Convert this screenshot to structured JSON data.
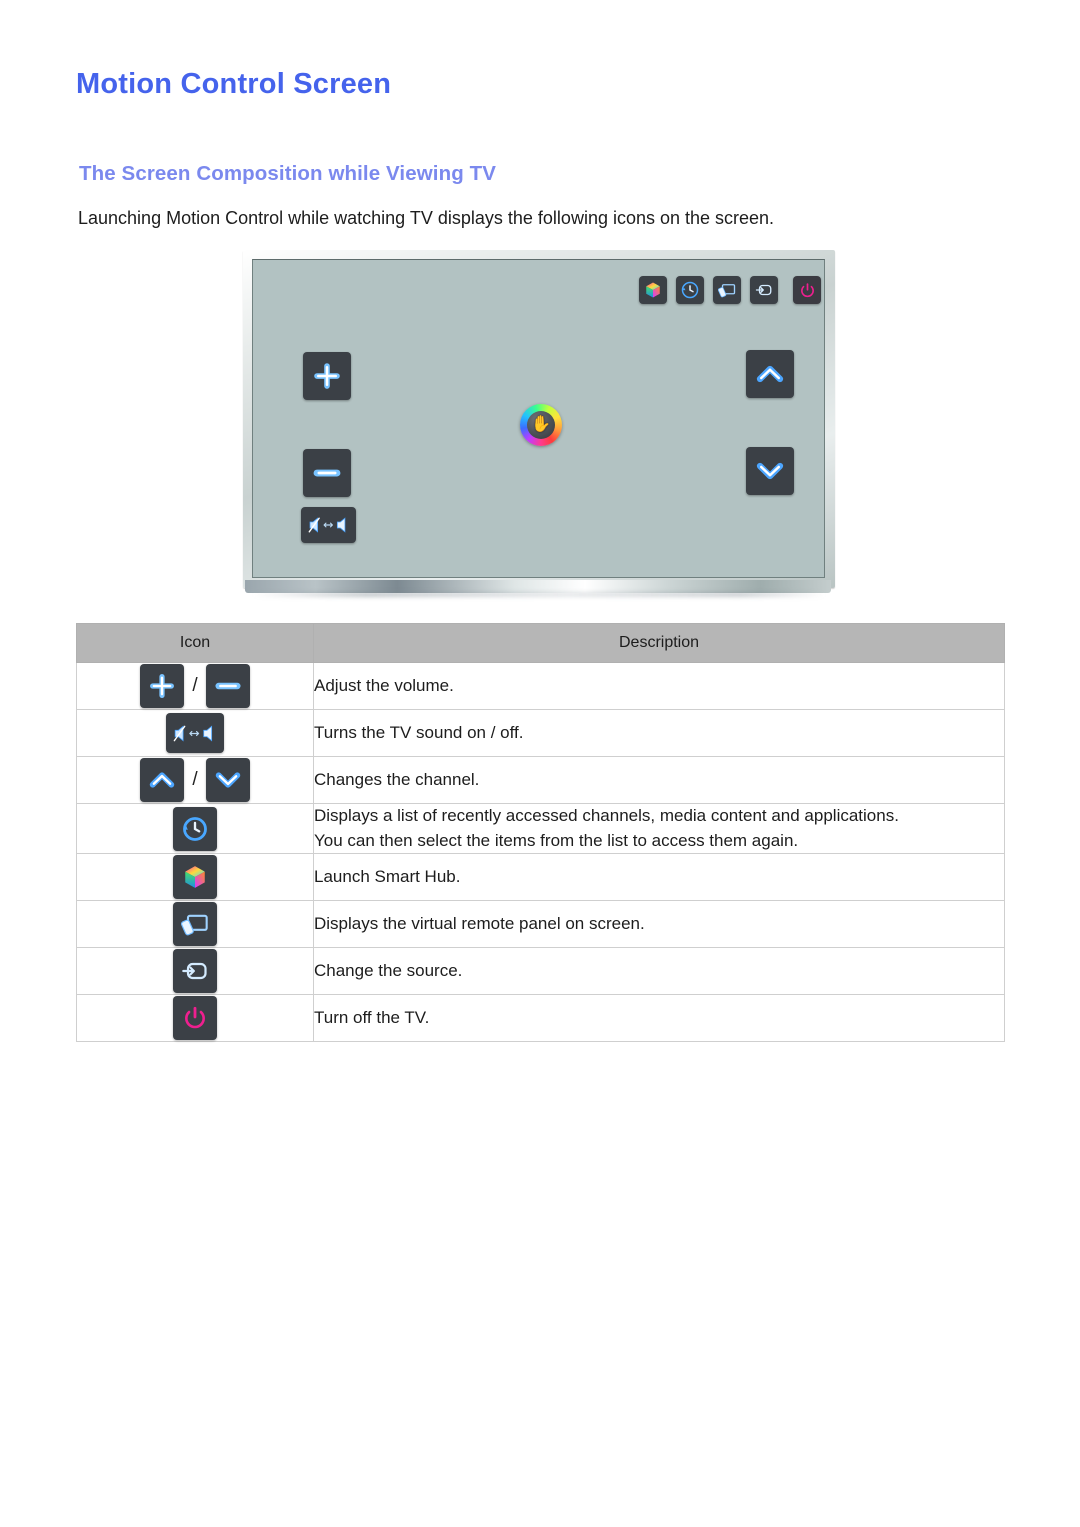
{
  "document": {
    "title": "Motion Control Screen",
    "subtitle": "The Screen Composition while Viewing TV",
    "intro": "Launching Motion Control while watching TV displays the following icons on the screen."
  },
  "colors": {
    "title_blue": "#4563ec",
    "subtitle_blue": "#7b89ee",
    "table_header_gray": "#b6b6b6",
    "tv_screen": "#b2c2c2",
    "icon_tile": "#3b4046",
    "icon_glow_blue": "#2e86ff",
    "power_magenta": "#ef1f8f"
  },
  "tv_illustration": {
    "name": "tv-screen-overlay",
    "onscreen_icons": [
      {
        "id": "volume-up",
        "icon": "plus-icon",
        "position": "left-upper"
      },
      {
        "id": "volume-down",
        "icon": "minus-icon",
        "position": "left-lower"
      },
      {
        "id": "mute-toggle",
        "icon": "mute-speaker-toggle-icon",
        "position": "left-bottom"
      },
      {
        "id": "channel-up",
        "icon": "chevron-up-icon",
        "position": "right-upper"
      },
      {
        "id": "channel-down",
        "icon": "chevron-down-icon",
        "position": "right-lower"
      },
      {
        "id": "smart-hub",
        "icon": "smart-hub-cube-icon",
        "position": "top-right-bar"
      },
      {
        "id": "recent",
        "icon": "clock-history-icon",
        "position": "top-right-bar"
      },
      {
        "id": "virtual-remote",
        "icon": "virtual-remote-panel-icon",
        "position": "top-right-bar"
      },
      {
        "id": "source",
        "icon": "source-input-icon",
        "position": "top-right-bar"
      },
      {
        "id": "power",
        "icon": "power-icon",
        "position": "top-right-bar"
      }
    ],
    "cursor": {
      "icon": "hand-cursor-icon",
      "glyph": "✋"
    }
  },
  "table": {
    "headers": {
      "icon": "Icon",
      "description": "Description"
    },
    "rows": [
      {
        "icons": [
          "plus-icon",
          "minus-icon"
        ],
        "separator": "/",
        "description": "Adjust the volume."
      },
      {
        "icons": [
          "mute-speaker-toggle-icon"
        ],
        "separator": "",
        "description": "Turns the TV sound on / off."
      },
      {
        "icons": [
          "chevron-up-icon",
          "chevron-down-icon"
        ],
        "separator": "/",
        "description": "Changes the channel."
      },
      {
        "icons": [
          "clock-history-icon"
        ],
        "separator": "",
        "description": "Displays a list of recently accessed channels, media content and applications.",
        "description_line2": "You can then select the items from the list to access them again."
      },
      {
        "icons": [
          "smart-hub-cube-icon"
        ],
        "separator": "",
        "description": "Launch Smart Hub."
      },
      {
        "icons": [
          "virtual-remote-panel-icon"
        ],
        "separator": "",
        "description": "Displays the virtual remote panel on screen."
      },
      {
        "icons": [
          "source-input-icon"
        ],
        "separator": "",
        "description": "Change the source."
      },
      {
        "icons": [
          "power-icon"
        ],
        "separator": "",
        "description": "Turn off the TV."
      }
    ]
  }
}
